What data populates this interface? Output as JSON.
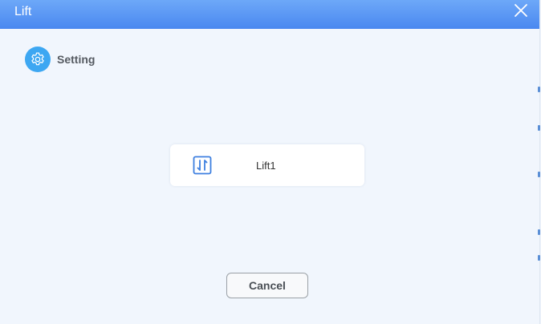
{
  "window": {
    "title": "Lift"
  },
  "section": {
    "label": "Setting",
    "icon": "gear-icon"
  },
  "lift_card": {
    "label": "Lift1",
    "icon": "up-down-arrows-icon"
  },
  "footer": {
    "cancel_label": "Cancel"
  },
  "colors": {
    "titlebar": "#4a88f0",
    "accent": "#3da7f2",
    "background": "#f1f6fd"
  }
}
